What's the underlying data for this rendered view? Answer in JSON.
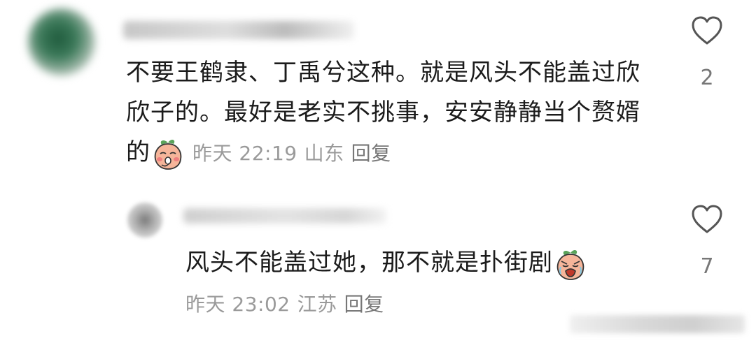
{
  "comments": [
    {
      "text": "不要王鹤隶、丁禹兮这种。就是风头不能盖过欣欣子的。最好是老实不挑事，安安静静当个赘婿的",
      "emoji_icon": "peach-shy-emoji-icon",
      "time": "昨天 22:19",
      "location": "山东",
      "reply_label": "回复",
      "likes": "2"
    },
    {
      "text": "风头不能盖过她，那不就是扑街剧",
      "emoji_icon": "peach-crying-emoji-icon",
      "time": "昨天 23:02",
      "location": "江苏",
      "reply_label": "回复",
      "likes": "7"
    }
  ],
  "colors": {
    "text": "#1b1b1b",
    "meta": "#9a9a9a",
    "heart_outline": "#555555",
    "emoji_peach": "#f6b59a",
    "emoji_leaf": "#5aa35a"
  }
}
